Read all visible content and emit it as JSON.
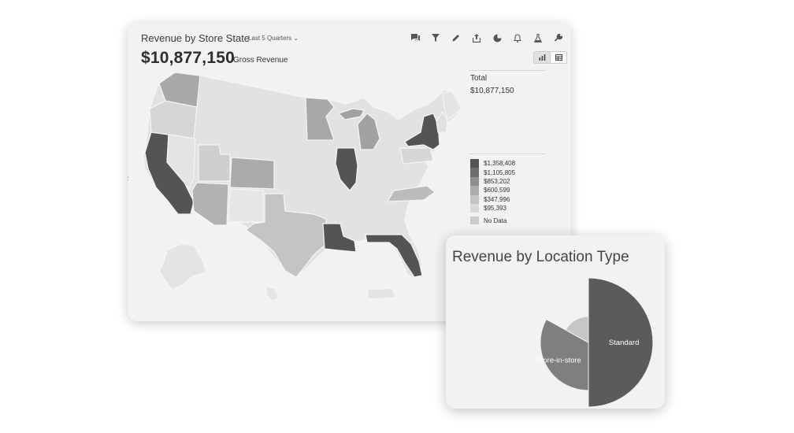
{
  "main_card": {
    "title": "Revenue by Store State",
    "period": "Last 5 Quarters ⌄",
    "gross_value": "$10,877,150",
    "gross_label": "Gross Revenue",
    "toolbar": [
      "comment-icon",
      "filter-icon",
      "pencil-icon",
      "share-icon",
      "pie-icon",
      "bell-icon",
      "flask-icon",
      "wrench-icon"
    ],
    "view_toggle": [
      "bar-chart-icon",
      "table-icon"
    ],
    "total_label": "Total",
    "total_value": "$10,877,150",
    "legend": [
      {
        "label": "$1,358,408",
        "color": "#555555"
      },
      {
        "label": "$1,105,805",
        "color": "#6e6e6e"
      },
      {
        "label": "$853,202",
        "color": "#8f8f8f"
      },
      {
        "label": "$600,599",
        "color": "#acacac"
      },
      {
        "label": "$347,996",
        "color": "#c4c4c4"
      },
      {
        "label": "$95,393",
        "color": "#d9d9d9"
      }
    ],
    "no_data": {
      "label": "No Data",
      "color": "#cbcbcb"
    },
    "map_base_color": "#e2e2e2"
  },
  "chart_data": {
    "type": "pie",
    "title": "Revenue by Location Type",
    "slices": [
      {
        "label": "Standard",
        "value": 50,
        "color": "#5b5b5b"
      },
      {
        "label": "Store-in-store",
        "value": 33,
        "color": "#7f7f7f"
      },
      {
        "label": "",
        "value": 17,
        "color": "#c6c6c6"
      }
    ]
  }
}
